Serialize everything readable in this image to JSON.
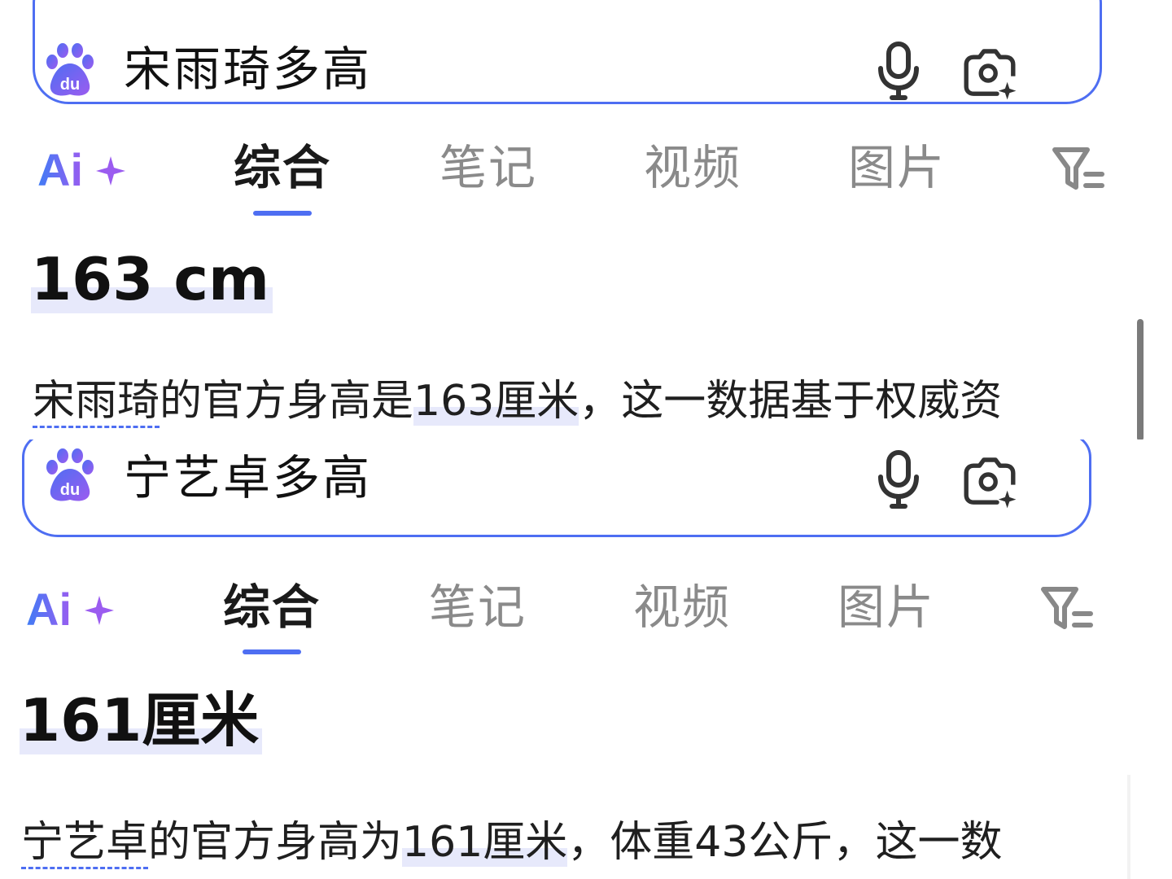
{
  "colors": {
    "accent": "#4e6ef2",
    "highlight": "#e7e9fb",
    "text_primary": "#111111",
    "text_muted": "#8a8a8a"
  },
  "panels": [
    {
      "search": {
        "query": "宋雨琦多高"
      },
      "tabs": {
        "items": [
          {
            "label": "综合",
            "active": true
          },
          {
            "label": "笔记",
            "active": false
          },
          {
            "label": "视频",
            "active": false
          },
          {
            "label": "图片",
            "active": false
          }
        ]
      },
      "result": {
        "answer": "163 cm",
        "desc_name": "宋雨琦",
        "desc_pre": "的官方身高是",
        "desc_value": "163厘米",
        "desc_post": "，这一数据基于权威资"
      }
    },
    {
      "search": {
        "query": "宁艺卓多高"
      },
      "tabs": {
        "items": [
          {
            "label": "综合",
            "active": true
          },
          {
            "label": "笔记",
            "active": false
          },
          {
            "label": "视频",
            "active": false
          },
          {
            "label": "图片",
            "active": false
          }
        ]
      },
      "result": {
        "answer": "161厘米",
        "desc_name": "宁艺卓",
        "desc_pre": "的官方身高为",
        "desc_value": "161厘米",
        "desc_post": "，体重43公斤，这一数"
      }
    }
  ],
  "icons": {
    "logo": "baidu-paw-logo",
    "mic": "microphone-icon",
    "camera": "camera-sparkle-icon",
    "ai": "ai-plus-icon",
    "filter": "filter-icon"
  }
}
